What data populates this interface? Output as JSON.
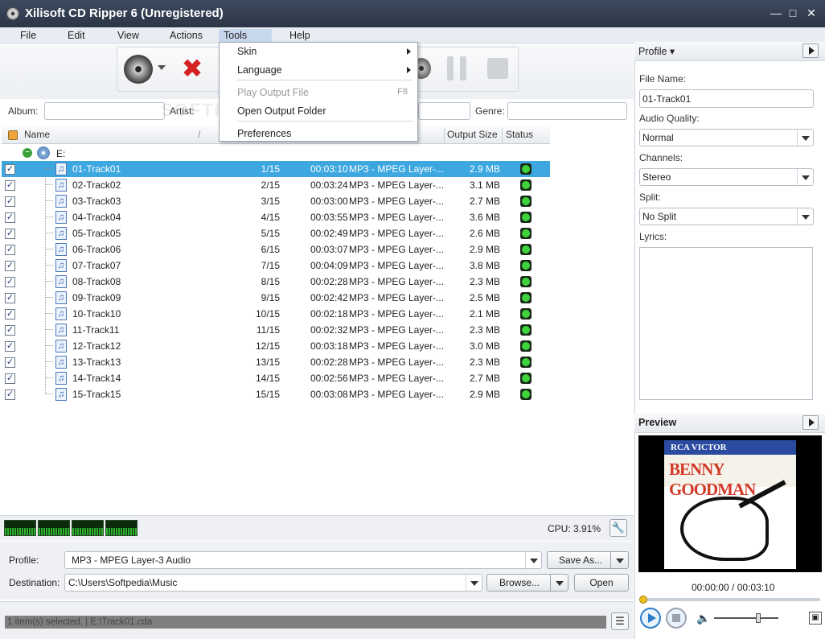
{
  "window": {
    "title": "Xilisoft CD Ripper 6 (Unregistered)"
  },
  "menubar": {
    "items": [
      "File",
      "Edit",
      "View",
      "Actions",
      "Tools",
      "Help"
    ]
  },
  "tools_menu": {
    "skin": "Skin",
    "language": "Language",
    "play_output": "Play Output File",
    "play_output_shortcut": "F8",
    "open_output_folder": "Open Output Folder",
    "preferences": "Preferences"
  },
  "fields": {
    "album_label": "Album:",
    "artist_label": "Artist:",
    "genre_label": "Genre:"
  },
  "table": {
    "headers": {
      "name": "Name",
      "output_size": "Output Size",
      "status": "Status"
    },
    "root": "E:[]",
    "rows": [
      {
        "name": "01-Track01",
        "idx": "1/15",
        "dur": "00:03:10",
        "fmt": "MP3 - MPEG Layer-...",
        "size": "2.9 MB"
      },
      {
        "name": "02-Track02",
        "idx": "2/15",
        "dur": "00:03:24",
        "fmt": "MP3 - MPEG Layer-...",
        "size": "3.1 MB"
      },
      {
        "name": "03-Track03",
        "idx": "3/15",
        "dur": "00:03:00",
        "fmt": "MP3 - MPEG Layer-...",
        "size": "2.7 MB"
      },
      {
        "name": "04-Track04",
        "idx": "4/15",
        "dur": "00:03:55",
        "fmt": "MP3 - MPEG Layer-...",
        "size": "3.6 MB"
      },
      {
        "name": "05-Track05",
        "idx": "5/15",
        "dur": "00:02:49",
        "fmt": "MP3 - MPEG Layer-...",
        "size": "2.6 MB"
      },
      {
        "name": "06-Track06",
        "idx": "6/15",
        "dur": "00:03:07",
        "fmt": "MP3 - MPEG Layer-...",
        "size": "2.9 MB"
      },
      {
        "name": "07-Track07",
        "idx": "7/15",
        "dur": "00:04:09",
        "fmt": "MP3 - MPEG Layer-...",
        "size": "3.8 MB"
      },
      {
        "name": "08-Track08",
        "idx": "8/15",
        "dur": "00:02:28",
        "fmt": "MP3 - MPEG Layer-...",
        "size": "2.3 MB"
      },
      {
        "name": "09-Track09",
        "idx": "9/15",
        "dur": "00:02:42",
        "fmt": "MP3 - MPEG Layer-...",
        "size": "2.5 MB"
      },
      {
        "name": "10-Track10",
        "idx": "10/15",
        "dur": "00:02:18",
        "fmt": "MP3 - MPEG Layer-...",
        "size": "2.1 MB"
      },
      {
        "name": "11-Track11",
        "idx": "11/15",
        "dur": "00:02:32",
        "fmt": "MP3 - MPEG Layer-...",
        "size": "2.3 MB"
      },
      {
        "name": "12-Track12",
        "idx": "12/15",
        "dur": "00:03:18",
        "fmt": "MP3 - MPEG Layer-...",
        "size": "3.0 MB"
      },
      {
        "name": "13-Track13",
        "idx": "13/15",
        "dur": "00:02:28",
        "fmt": "MP3 - MPEG Layer-...",
        "size": "2.3 MB"
      },
      {
        "name": "14-Track14",
        "idx": "14/15",
        "dur": "00:02:56",
        "fmt": "MP3 - MPEG Layer-...",
        "size": "2.7 MB"
      },
      {
        "name": "15-Track15",
        "idx": "15/15",
        "dur": "00:03:08",
        "fmt": "MP3 - MPEG Layer-...",
        "size": "2.9 MB"
      }
    ]
  },
  "cpu": {
    "text": "CPU: 3.91%"
  },
  "bottom": {
    "profile_label": "Profile:",
    "profile_value": "MP3 - MPEG Layer-3 Audio",
    "save_as": "Save As...",
    "destination_label": "Destination:",
    "destination_value": "C:\\Users\\Softpedia\\Music",
    "browse": "Browse...",
    "open": "Open"
  },
  "status": {
    "text": "1 item(s) selected. | E:\\Track01.cda"
  },
  "profile_panel": {
    "header": "Profile",
    "file_name_label": "File Name:",
    "file_name_value": "01-Track01",
    "audio_quality_label": "Audio Quality:",
    "audio_quality_value": "Normal",
    "channels_label": "Channels:",
    "channels_value": "Stereo",
    "split_label": "Split:",
    "split_value": "No Split",
    "lyrics_label": "Lyrics:"
  },
  "preview": {
    "header": "Preview",
    "time": "00:00:00 / 00:03:10",
    "cover_label": "RCA VICTOR",
    "cover_title": "BENNY GOODMAN"
  },
  "colors": {
    "selected_row": "#3da7e0",
    "status_ok": "#3ed33a",
    "titlebar": "#2b3546"
  }
}
